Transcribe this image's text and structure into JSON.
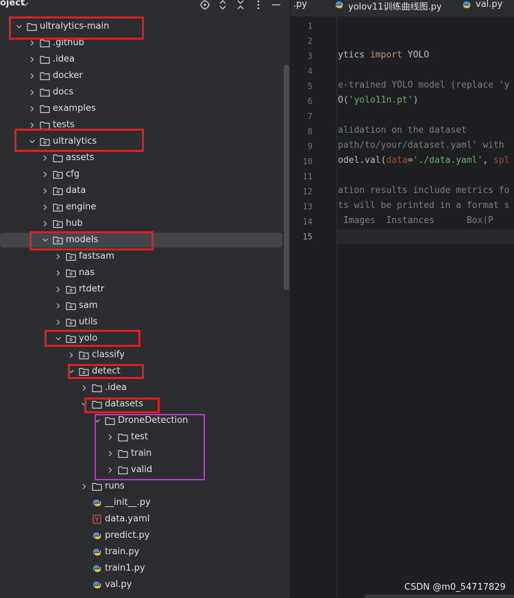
{
  "panel": {
    "title": "oject",
    "tree": [
      {
        "label": "ultralytics-main",
        "kind": "folder",
        "expanded": true,
        "depth": 0,
        "name": "tree-item-ultralytics-main"
      },
      {
        "label": ".github",
        "kind": "folder",
        "expanded": false,
        "depth": 1,
        "name": "tree-item-github"
      },
      {
        "label": ".idea",
        "kind": "folder",
        "expanded": false,
        "depth": 1,
        "name": "tree-item-idea"
      },
      {
        "label": "docker",
        "kind": "folder",
        "expanded": false,
        "depth": 1,
        "name": "tree-item-docker"
      },
      {
        "label": "docs",
        "kind": "folder",
        "expanded": false,
        "depth": 1,
        "name": "tree-item-docs"
      },
      {
        "label": "examples",
        "kind": "folder",
        "expanded": false,
        "depth": 1,
        "name": "tree-item-examples"
      },
      {
        "label": "tests",
        "kind": "folder",
        "expanded": false,
        "depth": 1,
        "name": "tree-item-tests"
      },
      {
        "label": "ultralytics",
        "kind": "package",
        "expanded": true,
        "depth": 1,
        "name": "tree-item-ultralytics"
      },
      {
        "label": "assets",
        "kind": "folder",
        "expanded": false,
        "depth": 2,
        "name": "tree-item-assets"
      },
      {
        "label": "cfg",
        "kind": "package",
        "expanded": false,
        "depth": 2,
        "name": "tree-item-cfg"
      },
      {
        "label": "data",
        "kind": "package",
        "expanded": false,
        "depth": 2,
        "name": "tree-item-data"
      },
      {
        "label": "engine",
        "kind": "package",
        "expanded": false,
        "depth": 2,
        "name": "tree-item-engine"
      },
      {
        "label": "hub",
        "kind": "package",
        "expanded": false,
        "depth": 2,
        "name": "tree-item-hub"
      },
      {
        "label": "models",
        "kind": "package",
        "expanded": true,
        "depth": 2,
        "name": "tree-item-models",
        "selected": true
      },
      {
        "label": "fastsam",
        "kind": "package",
        "expanded": false,
        "depth": 3,
        "name": "tree-item-fastsam"
      },
      {
        "label": "nas",
        "kind": "package",
        "expanded": false,
        "depth": 3,
        "name": "tree-item-nas"
      },
      {
        "label": "rtdetr",
        "kind": "package",
        "expanded": false,
        "depth": 3,
        "name": "tree-item-rtdetr"
      },
      {
        "label": "sam",
        "kind": "package",
        "expanded": false,
        "depth": 3,
        "name": "tree-item-sam"
      },
      {
        "label": "utils",
        "kind": "package",
        "expanded": false,
        "depth": 3,
        "name": "tree-item-utils"
      },
      {
        "label": "yolo",
        "kind": "package",
        "expanded": true,
        "depth": 3,
        "name": "tree-item-yolo"
      },
      {
        "label": "classify",
        "kind": "package",
        "expanded": false,
        "depth": 4,
        "name": "tree-item-classify"
      },
      {
        "label": "detect",
        "kind": "package",
        "expanded": true,
        "depth": 4,
        "name": "tree-item-detect"
      },
      {
        "label": ".idea",
        "kind": "folder",
        "expanded": false,
        "depth": 5,
        "name": "tree-item-detect-idea"
      },
      {
        "label": "datasets",
        "kind": "folder",
        "expanded": true,
        "depth": 5,
        "name": "tree-item-datasets"
      },
      {
        "label": "DroneDetection",
        "kind": "folder",
        "expanded": true,
        "depth": 6,
        "name": "tree-item-dronedetection"
      },
      {
        "label": "test",
        "kind": "folder",
        "expanded": false,
        "depth": 7,
        "name": "tree-item-test"
      },
      {
        "label": "train",
        "kind": "folder",
        "expanded": false,
        "depth": 7,
        "name": "tree-item-train"
      },
      {
        "label": "valid",
        "kind": "folder",
        "expanded": false,
        "depth": 7,
        "name": "tree-item-valid"
      },
      {
        "label": "runs",
        "kind": "folder",
        "expanded": false,
        "depth": 5,
        "name": "tree-item-runs"
      },
      {
        "label": "__init__.py",
        "kind": "python",
        "depth": 5,
        "name": "tree-item-init-py"
      },
      {
        "label": "data.yaml",
        "kind": "yaml",
        "depth": 5,
        "name": "tree-item-data-yaml"
      },
      {
        "label": "predict.py",
        "kind": "python",
        "depth": 5,
        "name": "tree-item-predict-py"
      },
      {
        "label": "train.py",
        "kind": "python",
        "depth": 5,
        "name": "tree-item-train-py"
      },
      {
        "label": "train1.py",
        "kind": "python",
        "depth": 5,
        "name": "tree-item-train1-py"
      },
      {
        "label": "val.py",
        "kind": "python",
        "depth": 5,
        "name": "tree-item-val-py"
      }
    ]
  },
  "tabs": {
    "t1": ".py",
    "t2": "yolov11训练曲线图.py",
    "t3": "val.py"
  },
  "editor": {
    "line_numbers": [
      "1",
      "2",
      "3",
      "4",
      "5",
      "6",
      "7",
      "8",
      "9",
      "10",
      "11",
      "12",
      "13",
      "14",
      "15"
    ],
    "current_line": "15"
  },
  "code": {
    "l3a": "ytics ",
    "l3b": "import",
    "l3c": " YOLO",
    "l5": "e-trained YOLO model (replace 'y",
    "l6a": "O(",
    "l6b": "'yolo11n.pt'",
    "l6c": ")",
    "l8": "alidation on the dataset",
    "l9": "path/to/your/dataset.yaml' with",
    "l10a": "odel.val(",
    "l10b": "data",
    "l10c": "=",
    "l10d": "'./data.yaml'",
    "l10e": ", ",
    "l10f": "spl",
    "l12": "ation results include metrics fo",
    "l13": "ts will be printed in a format s",
    "l14": " Images  Instances      Box(P"
  },
  "watermark": "CSDN @m0_54717829",
  "colors": {
    "highlight_red": "#e02020",
    "highlight_purple": "#b040c0",
    "selection": "#43454a"
  },
  "icons": {
    "header": [
      "locate-icon",
      "expand-collapse-icon",
      "close-icon",
      "more-icon",
      "minimize-icon"
    ]
  }
}
